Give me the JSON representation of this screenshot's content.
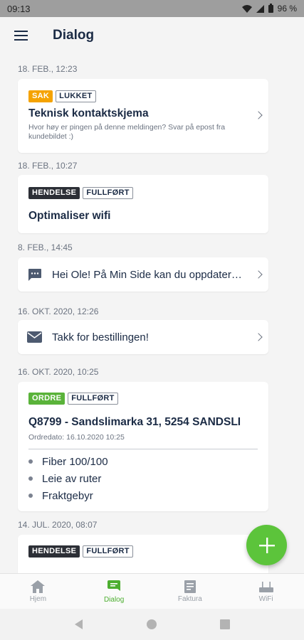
{
  "status_bar": {
    "time": "09:13",
    "battery": "96 %"
  },
  "app_bar": {
    "title": "Dialog"
  },
  "feed": [
    {
      "timestamp": "18. FEB., 12:23",
      "tags": [
        "SAK",
        "LUKKET"
      ],
      "title": "Teknisk kontaktskjema",
      "subtitle": "Hvor høy er pingen på denne meldingen? Svar på epost fra kundebildet :)"
    },
    {
      "timestamp": "18. FEB., 10:27",
      "tags": [
        "HENDELSE",
        "FULLFØRT"
      ],
      "title": "Optimaliser wifi"
    },
    {
      "timestamp": "8. FEB., 14:45",
      "text": "Hei Ole! På Min Side kan du oppdater…"
    },
    {
      "timestamp": "16. OKT. 2020, 12:26",
      "text": "Takk for bestillingen!"
    },
    {
      "timestamp": "16. OKT. 2020, 10:25",
      "tags": [
        "ORDRE",
        "FULLFØRT"
      ],
      "title": "Q8799 - Sandslimarka 31, 5254 SANDSLI",
      "order_date": "Ordredato: 16.10.2020 10:25",
      "items": [
        "Fiber 100/100",
        "Leie av ruter",
        "Fraktgebyr"
      ]
    },
    {
      "timestamp": "14. JUL. 2020, 08:07",
      "tags": [
        "HENDELSE",
        "FULLFØRT"
      ]
    }
  ],
  "bottom_nav": [
    {
      "label": "Hjem",
      "icon": "home-icon"
    },
    {
      "label": "Dialog",
      "icon": "chat-icon",
      "active": true
    },
    {
      "label": "Faktura",
      "icon": "invoice-icon"
    },
    {
      "label": "WiFi",
      "icon": "router-icon"
    }
  ],
  "colors": {
    "accent_green": "#5cc43b",
    "sak": "#f5a300",
    "hendelse": "#2c2f36",
    "ordre": "#5ab33a",
    "text_dark": "#1b2b45"
  }
}
